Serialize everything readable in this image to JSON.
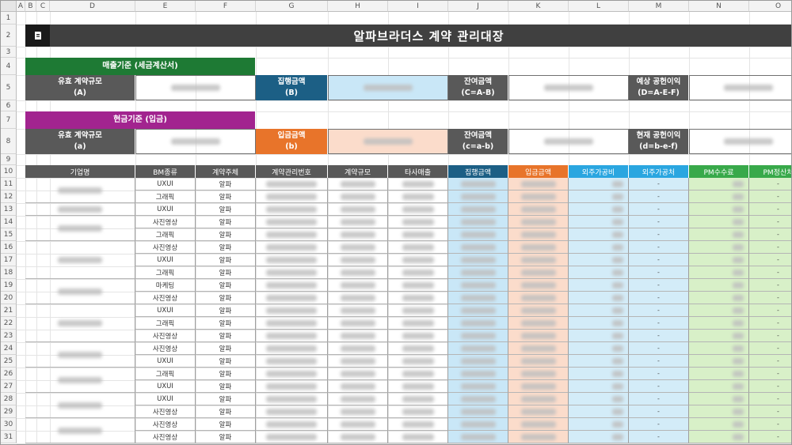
{
  "columns": [
    "A",
    "B",
    "C",
    "D",
    "E",
    "F",
    "G",
    "H",
    "I",
    "J",
    "K",
    "L",
    "M",
    "N",
    "O"
  ],
  "rows": [
    "1",
    "2",
    "3",
    "4",
    "5",
    "6",
    "7",
    "8",
    "9",
    "10",
    "11",
    "12",
    "13",
    "14",
    "15",
    "16",
    "17",
    "18",
    "19",
    "20",
    "21",
    "22",
    "23",
    "24",
    "25",
    "26",
    "27",
    "28",
    "29",
    "30",
    "31"
  ],
  "title": "알파브라더스 계약 관리대장",
  "sales_basis": {
    "header": "매출기준 (세금계산서)",
    "valid_scale": [
      "유효 계약규모",
      "(A)"
    ],
    "exec_amount": [
      "집행금액",
      "(B)"
    ],
    "remain_amount": [
      "잔여금액",
      "(C=A-B)"
    ],
    "expected_contribution": [
      "예상 공헌이익",
      "(D=A-E-F)"
    ]
  },
  "cash_basis": {
    "header": "현금기준 (입금)",
    "valid_scale": [
      "유효 계약규모",
      "(a)"
    ],
    "deposit_amount": [
      "입금금액",
      "(b)"
    ],
    "remain_amount": [
      "잔여금액",
      "(c=a-b)"
    ],
    "current_contribution": [
      "현재 공헌이익",
      "(d=b-e-f)"
    ]
  },
  "table_headers": [
    "기업명",
    "BM종류",
    "계약주체",
    "계약관리번호",
    "계약규모",
    "타사매출",
    "집행금액",
    "입금금액",
    "외주가공비",
    "외주가공처",
    "PM수수료",
    "PM정산처"
  ],
  "table_rows": [
    {
      "bm": "UXUI",
      "entity": "알파"
    },
    {
      "bm": "그래픽",
      "entity": "알파"
    },
    {
      "bm": "UXUI",
      "entity": "알파"
    },
    {
      "bm": "사진영상",
      "entity": "알파"
    },
    {
      "bm": "그래픽",
      "entity": "알파"
    },
    {
      "bm": "사진영상",
      "entity": "알파"
    },
    {
      "bm": "UXUI",
      "entity": "알파"
    },
    {
      "bm": "그래픽",
      "entity": "알파"
    },
    {
      "bm": "마케팅",
      "entity": "알파"
    },
    {
      "bm": "사진영상",
      "entity": "알파"
    },
    {
      "bm": "UXUI",
      "entity": "알파"
    },
    {
      "bm": "그래픽",
      "entity": "알파"
    },
    {
      "bm": "사진영상",
      "entity": "알파"
    },
    {
      "bm": "사진영상",
      "entity": "알파"
    },
    {
      "bm": "UXUI",
      "entity": "알파"
    },
    {
      "bm": "그래픽",
      "entity": "알파"
    },
    {
      "bm": "UXUI",
      "entity": "알파"
    },
    {
      "bm": "UXUI",
      "entity": "알파"
    },
    {
      "bm": "사진영상",
      "entity": "알파"
    },
    {
      "bm": "사진영상",
      "entity": "알파"
    },
    {
      "bm": "사진영상",
      "entity": "알파"
    }
  ],
  "dash": "-",
  "icons": {
    "logo": "document-icon"
  },
  "colors": {
    "title_bg": "#404040",
    "label_gray": "#595959",
    "sales_green": "#1e7a34",
    "cash_purple": "#a2248f",
    "exec_blue": "#1c5f85",
    "exec_light": "#c9e7f7",
    "deposit_orange": "#e8742a",
    "deposit_light": "#fbdccb",
    "outsource_blue": "#2aa6e0",
    "outsource_light": "#d3ecf8",
    "pm_green": "#38a94a",
    "pm_light": "#d8f0c8"
  }
}
